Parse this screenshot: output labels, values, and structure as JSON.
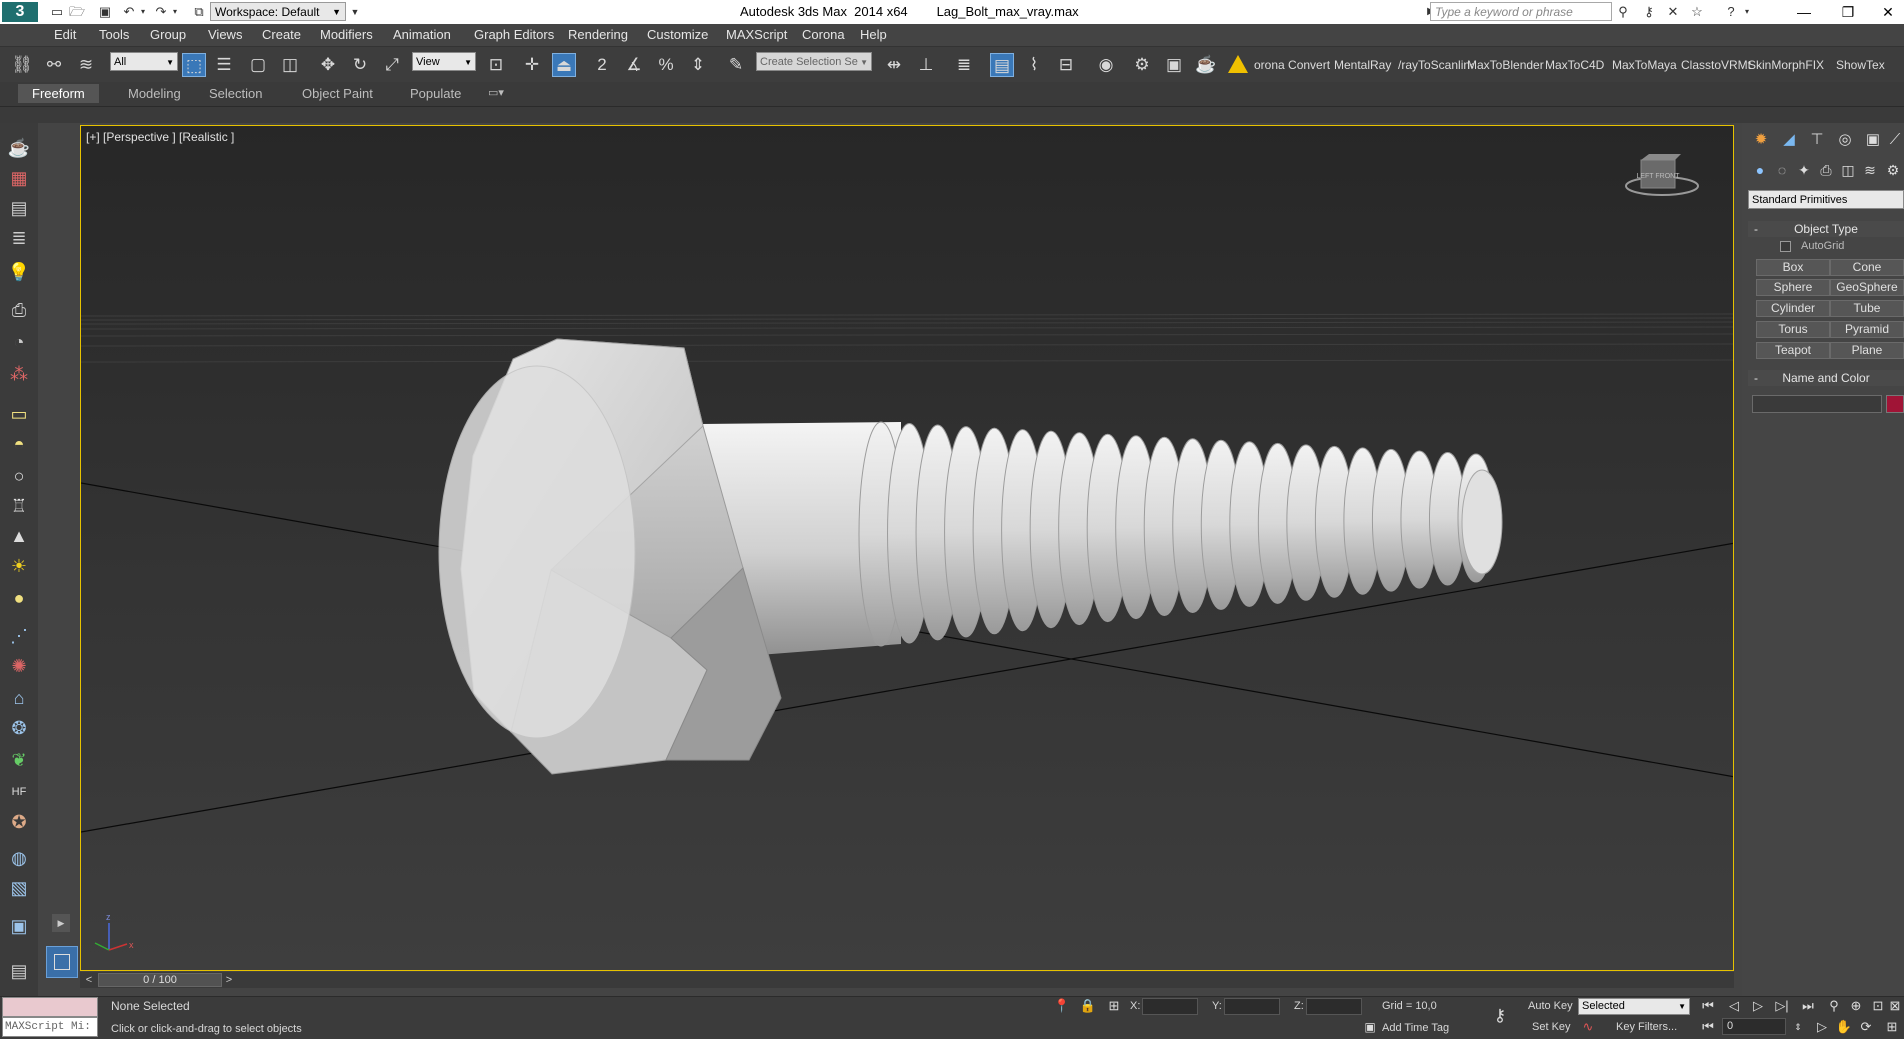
{
  "titlebar": {
    "app_logo": "3",
    "workspace": "Workspace: Default",
    "app_title": "Autodesk 3ds Max  2014 x64",
    "file_name": "Lag_Bolt_max_vray.max",
    "search_placeholder": "Type a keyword or phrase"
  },
  "menu": [
    "Edit",
    "Tools",
    "Group",
    "Views",
    "Create",
    "Modifiers",
    "Animation",
    "Graph Editors",
    "Rendering",
    "Customize",
    "MAXScript",
    "Corona",
    "Help"
  ],
  "toolbar": {
    "filter_select": "All",
    "ref_coord_select": "View",
    "named_selection": "Create Selection Se",
    "angle_snap": "2",
    "script_buttons": [
      "orona Convert",
      "MentalRay",
      "/rayToScanlin‹",
      "MaxToBlender",
      "MaxToC4D",
      "MaxToMaya",
      "ClasstoVRMt",
      "SkinMorphFIX",
      "ShowTex"
    ]
  },
  "ribbon": {
    "tabs": [
      "Freeform",
      "Modeling",
      "Selection",
      "Object Paint",
      "Populate"
    ]
  },
  "viewport": {
    "label": "[+] [Perspective ] [Realistic ]",
    "viewcube_text": "LEFT  FRONT"
  },
  "command_panel": {
    "category_select": "Standard Primitives",
    "object_type_title": "Object Type",
    "autogrid_label": "AutoGrid",
    "autogrid_checked": false,
    "buttons": [
      "Box",
      "Cone",
      "Sphere",
      "GeoSphere",
      "Cylinder",
      "Tube",
      "Torus",
      "Pyramid",
      "Teapot",
      "Plane"
    ],
    "name_color_title": "Name and Color",
    "object_name": "",
    "object_color": "#a01436"
  },
  "timeline": {
    "frame_display": "0 / 100",
    "current_frame": 0,
    "total_frames": 100
  },
  "status": {
    "maxscript_label": "MAXScript Mi:",
    "selection_status": "None Selected",
    "prompt": "Click or click-and-drag to select objects",
    "x_label": "X:",
    "y_label": "Y:",
    "z_label": "Z:",
    "grid": "Grid = 10,0",
    "add_time_tag": "Add Time Tag",
    "auto_key": "Auto Key",
    "set_key": "Set Key",
    "key_mode_select": "Selected",
    "key_filters": "Key Filters...",
    "frame_field": "0"
  },
  "colors": {
    "viewport_border": "#e6c200",
    "accent_active": "#3a78b8",
    "object_color": "#a01436"
  }
}
